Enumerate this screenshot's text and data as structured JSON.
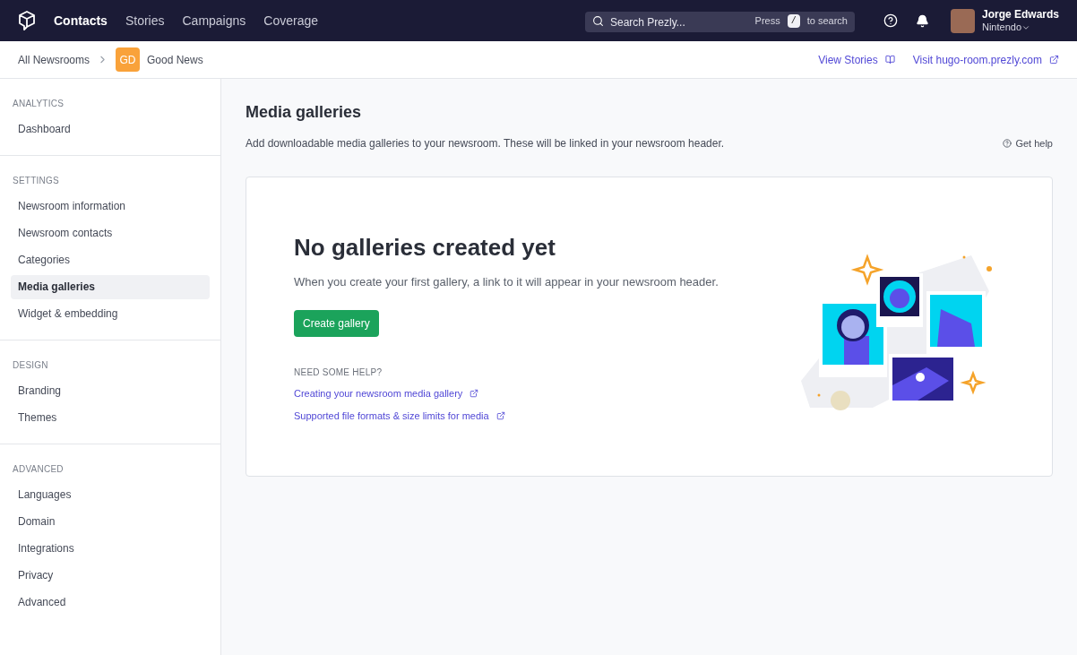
{
  "nav": {
    "items": [
      {
        "label": "Contacts",
        "selected": true
      },
      {
        "label": "Stories",
        "selected": false
      },
      {
        "label": "Campaigns",
        "selected": false
      },
      {
        "label": "Coverage",
        "selected": false
      }
    ],
    "search": {
      "placeholder": "Search Prezly...",
      "hint_before": "Press",
      "key": "/",
      "hint_after": "to search"
    },
    "user": {
      "name": "Jorge Edwards",
      "org": "Nintendo"
    }
  },
  "breadcrumb": {
    "root": "All Newsrooms",
    "badge": "GD",
    "current": "Good News",
    "links": [
      "View Stories",
      "Visit hugo-room.prezly.com"
    ]
  },
  "sidebar": [
    {
      "heading": "ANALYTICS",
      "items": [
        {
          "label": "Dashboard",
          "selected": false
        }
      ]
    },
    {
      "heading": "SETTINGS",
      "items": [
        {
          "label": "Newsroom information",
          "selected": false
        },
        {
          "label": "Newsroom contacts",
          "selected": false
        },
        {
          "label": "Categories",
          "selected": false
        },
        {
          "label": "Media galleries",
          "selected": true
        },
        {
          "label": "Widget & embedding",
          "selected": false
        }
      ]
    },
    {
      "heading": "DESIGN",
      "items": [
        {
          "label": "Branding",
          "selected": false
        },
        {
          "label": "Themes",
          "selected": false
        }
      ]
    },
    {
      "heading": "ADVANCED",
      "items": [
        {
          "label": "Languages",
          "selected": false
        },
        {
          "label": "Domain",
          "selected": false
        },
        {
          "label": "Integrations",
          "selected": false
        },
        {
          "label": "Privacy",
          "selected": false
        },
        {
          "label": "Advanced",
          "selected": false
        }
      ]
    }
  ],
  "page": {
    "title": "Media galleries",
    "description": "Add downloadable media galleries to your newsroom. These will be linked in your newsroom header.",
    "help": "Get help",
    "empty": {
      "title": "No galleries created yet",
      "text": "When you create your first gallery, a link to it will appear in your newsroom header.",
      "button": "Create gallery",
      "help_heading": "NEED SOME HELP?",
      "links": [
        "Creating your newsroom media gallery",
        "Supported file formats & size limits for media"
      ]
    }
  }
}
